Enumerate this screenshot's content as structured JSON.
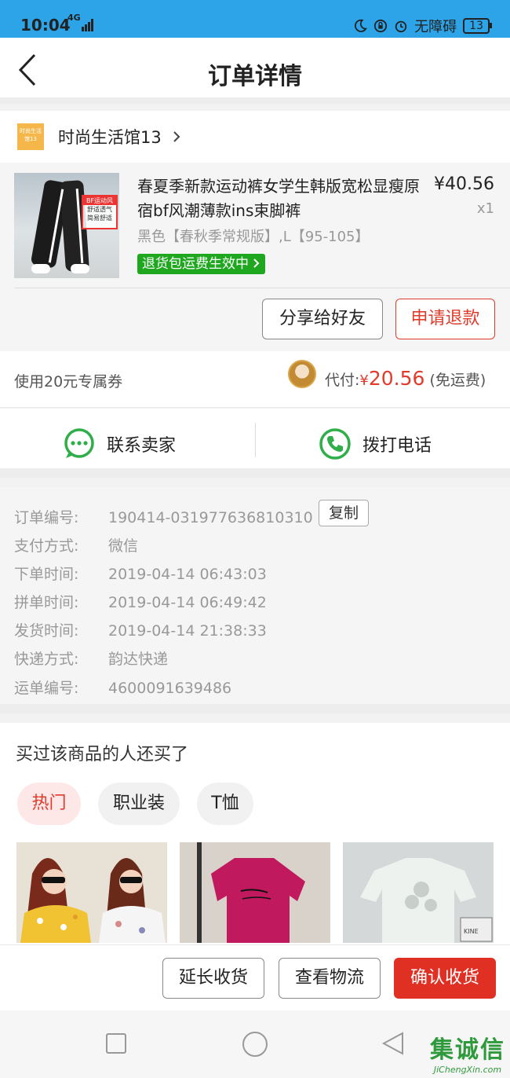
{
  "status_bar": {
    "time": "10:04",
    "network": "4G",
    "accessibility": "无障碍",
    "battery": "13"
  },
  "nav": {
    "title": "订单详情"
  },
  "shop": {
    "logo_text": "时尚生活馆13",
    "name": "时尚生活馆13"
  },
  "product": {
    "title": "春夏季新款运动裤女学生韩版宽松显瘦原宿bf风潮薄款ins束脚裤",
    "price": "¥40.56",
    "quantity": "x1",
    "spec": "黑色【春秋季常规版】,L【95-105】",
    "badge": "退货包运费生效中",
    "thumb_tag_line1": "BF运动风",
    "thumb_tag_line2": "舒适透气",
    "thumb_tag_line3": "简易舒适",
    "share_label": "分享给好友",
    "refund_label": "申请退款"
  },
  "coupon": {
    "label": "使用20元专属券",
    "pay_prefix": "代付:",
    "currency": "¥",
    "amount": "20.56",
    "shipping": "(免运费)"
  },
  "contact": {
    "seller_label": "联系卖家",
    "phone_label": "拨打电话"
  },
  "order_info": {
    "copy_label": "复制",
    "rows": [
      {
        "key": "订单编号:",
        "value": "190414-031977636810310"
      },
      {
        "key": "支付方式:",
        "value": "微信"
      },
      {
        "key": "下单时间:",
        "value": "2019-04-14 06:43:03"
      },
      {
        "key": "拼单时间:",
        "value": "2019-04-14 06:49:42"
      },
      {
        "key": "发货时间:",
        "value": "2019-04-14 21:38:33"
      },
      {
        "key": "快递方式:",
        "value": "韵达快递"
      },
      {
        "key": "运单编号:",
        "value": "4600091639486"
      }
    ]
  },
  "recommend": {
    "heading": "买过该商品的人还买了",
    "tabs": [
      "热门",
      "职业装",
      "T恤"
    ],
    "card3_tag": "KINE"
  },
  "bottom_bar": {
    "extend_label": "延长收货",
    "logistics_label": "查看物流",
    "confirm_label": "确认收货"
  },
  "watermark": {
    "cn": "集诚信",
    "en": "JiChengXin.com"
  },
  "colors": {
    "status_bar": "#2da4e8",
    "accent_red": "#e03b2b",
    "badge_green": "#1fa81f",
    "icon_green": "#2fae4a"
  }
}
